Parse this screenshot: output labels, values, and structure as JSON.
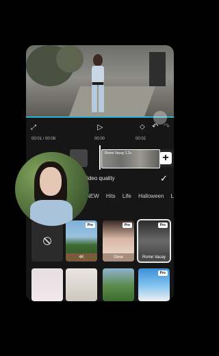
{
  "timeline": {
    "current_time": "00:01",
    "total_time": "00:08",
    "marker_1": "00:00",
    "marker_2": "00:02",
    "clip_label": "Rome Vacay 1.2s"
  },
  "sheet": {
    "title": "Video quality",
    "confirm_icon": "check-icon"
  },
  "tabs": [
    "NEW",
    "Hits",
    "Life",
    "Halloween",
    "Li"
  ],
  "filters": [
    {
      "name": "",
      "pro": false
    },
    {
      "name": "4K",
      "pro": true
    },
    {
      "name": "Glow",
      "pro": true
    },
    {
      "name": "Rome Vacay",
      "pro": true,
      "selected": true
    }
  ],
  "row2": [
    {
      "pro": false
    },
    {
      "pro": false
    },
    {
      "pro": false
    },
    {
      "pro": true
    }
  ],
  "pro_label": "Pro",
  "colors": {
    "accent": "#2bb5d3",
    "background": "#161616"
  }
}
